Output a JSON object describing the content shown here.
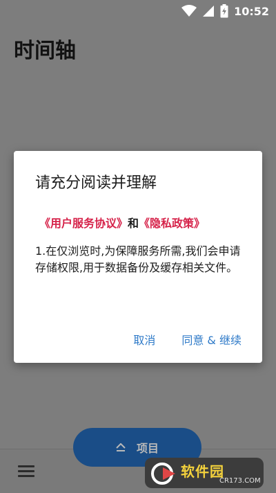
{
  "status_bar": {
    "time": "10:52",
    "icons": [
      "wifi-icon",
      "signal-icon",
      "battery-charging-icon"
    ]
  },
  "page": {
    "title": "时间轴"
  },
  "dialog": {
    "title": "请充分阅读并理解",
    "user_agreement": "《用户服务协议》",
    "conjunction": "和",
    "privacy_policy": "《隐私政策》",
    "body": "1.在仅浏览时,为保障服务所需,我们会申请存储权限,用于数据备份及缓存相关文件。",
    "cancel_label": "取消",
    "agree_label": "同意 & 继续"
  },
  "bottom_bar": {
    "menu_icon": "hamburger-menu-icon",
    "fab_label": "项目",
    "fab_icon": "chevron-up-icon"
  },
  "watermark": {
    "brand": "软件园",
    "site": "CR173.COM"
  },
  "colors": {
    "link": "#d6234a",
    "action": "#2e7ac8",
    "fab": "#1a4d87"
  }
}
